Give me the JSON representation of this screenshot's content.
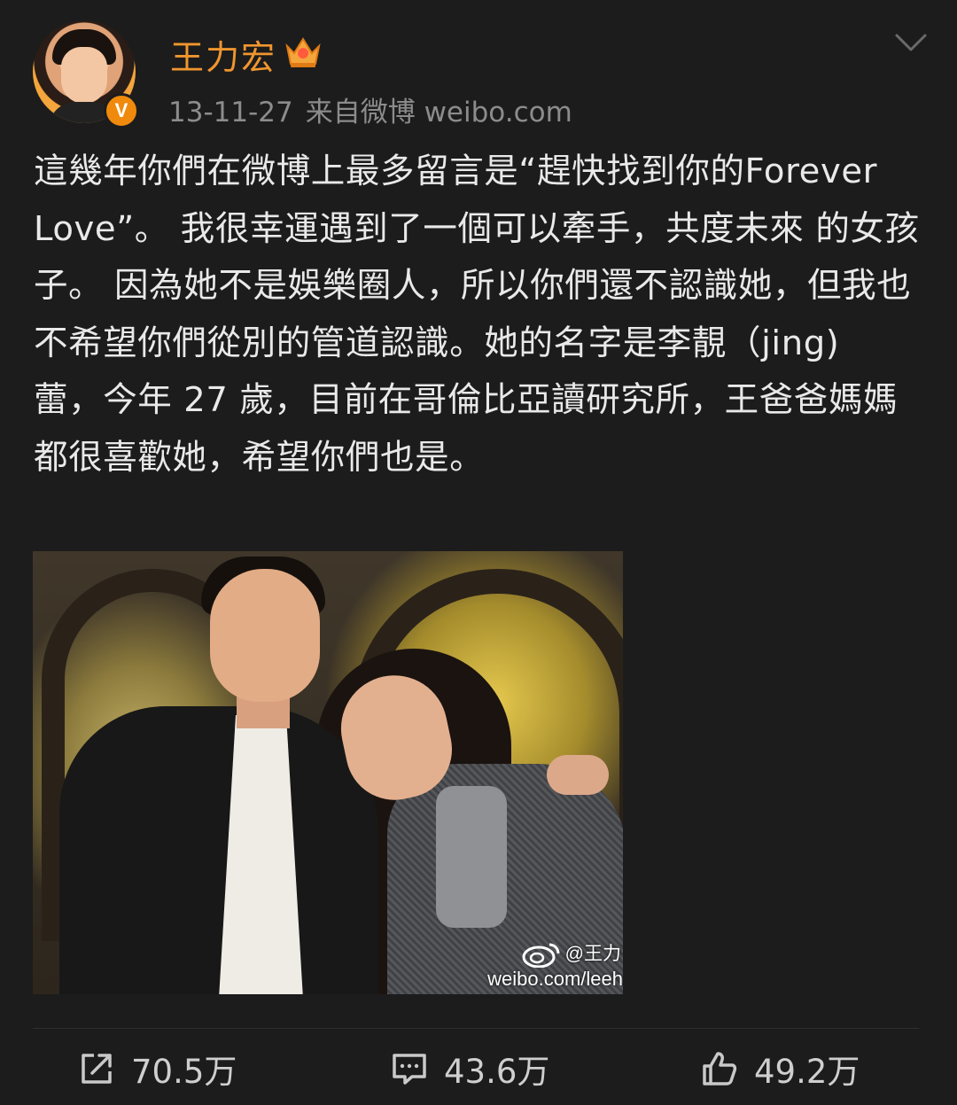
{
  "header": {
    "username": "王力宏",
    "verified_badge": "V",
    "timestamp": "13-11-27",
    "source": "来自微博 weibo.com"
  },
  "post": {
    "text": "這幾年你們在微博上最多留言是“趕快找到你的Forever Love”。 我很幸運遇到了一個可以牽手，共度未來 的女孩子。 因為她不是娛樂圈人，所以你們還不認識她，但我也不希望你們從別的管道認識。她的名字是李靚（jing) 蕾，今年 27 歲，目前在哥倫比亞讀研究所，王爸爸媽媽都很喜歡她，希望你們也是。"
  },
  "photo": {
    "watermark_handle": "@王力",
    "watermark_url": "weibo.com/leeh"
  },
  "actions": {
    "repost_count": "70.5万",
    "comment_count": "43.6万",
    "like_count": "49.2万"
  },
  "colors": {
    "background": "#1c1c1d",
    "username": "#f0962e",
    "verified": "#f08a0c",
    "meta": "#8c8c8c",
    "text": "#e9e9e9"
  }
}
